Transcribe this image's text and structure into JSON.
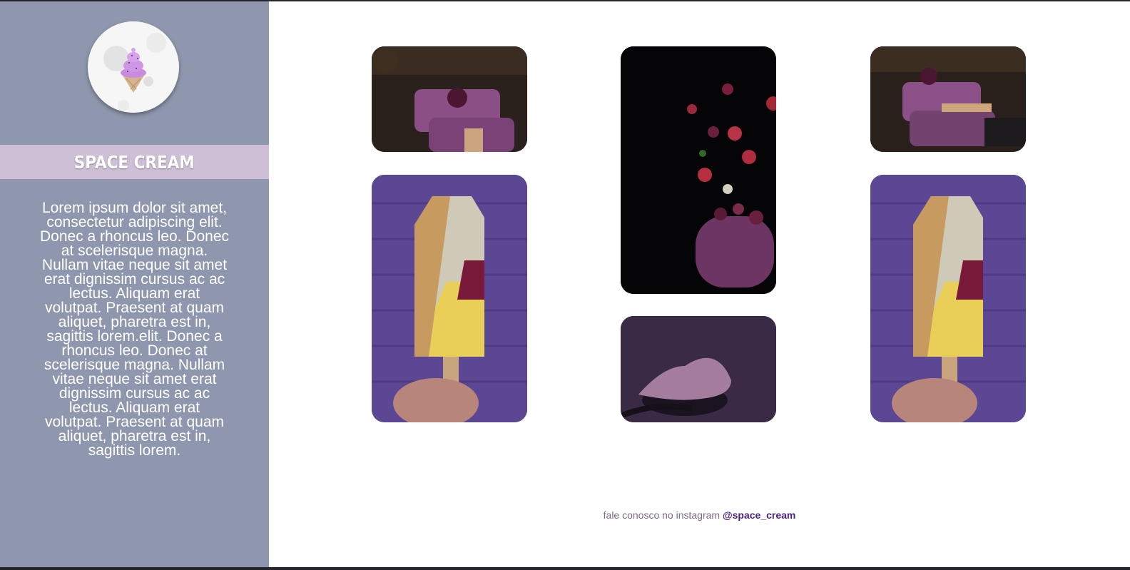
{
  "brand": {
    "name": "SPACE CREAM"
  },
  "sidebar": {
    "description": "Lorem ipsum dolor sit amet, consectetur adipiscing elit. Donec a rhoncus leo. Donec at scelerisque magna. Nullam vitae neque sit amet erat dignissim cursus ac ac lectus. Aliquam erat volutpat. Praesent at quam aliquet, pharetra est in, sagittis lorem.elit. Donec a rhoncus leo. Donec at scelerisque magna. Nullam vitae neque sit amet erat dignissim cursus ac ac lectus. Aliquam erat volutpat. Praesent at quam aliquet, pharetra est in, sagittis lorem."
  },
  "gallery": {
    "photos": [
      {
        "subject": "popsicle-berry"
      },
      {
        "subject": "berries-falling-jar"
      },
      {
        "subject": "popsicle-berry"
      },
      {
        "subject": "popsicle-nuts"
      },
      {
        "subject": "ice-cream-scoop"
      },
      {
        "subject": "popsicle-nuts"
      }
    ]
  },
  "footer": {
    "text": "fale conosco no instagram ",
    "handle": "@space_cream"
  },
  "colors": {
    "sidebar": "#8f97ae",
    "title_band": "#cfbfd6",
    "accent": "#4b1f7e"
  }
}
